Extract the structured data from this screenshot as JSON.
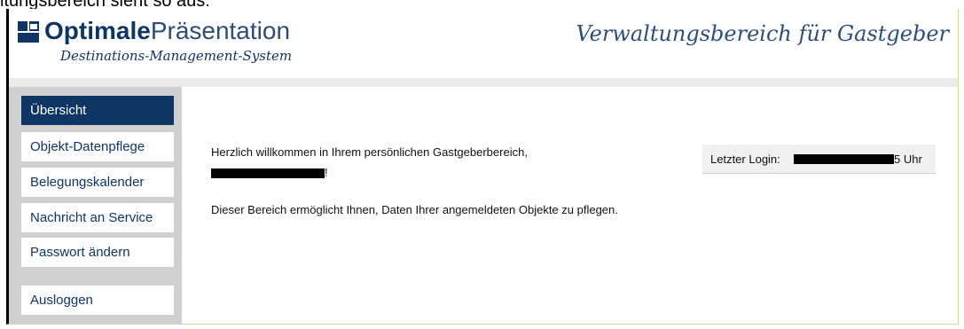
{
  "caption": "ltungsbereich sieht so aus:",
  "header": {
    "brand_bold": "Optimale",
    "brand_light": "Präsentation",
    "subtitle": "Destinations-Management-System",
    "right_title": "Verwaltungsbereich für Gastgeber"
  },
  "sidebar": {
    "items": [
      {
        "label": "Übersicht"
      },
      {
        "label": "Objekt-Datenpflege"
      },
      {
        "label": "Belegungskalender"
      },
      {
        "label": "Nachricht an Service"
      },
      {
        "label": "Passwort ändern"
      },
      {
        "label": "Ausloggen"
      }
    ]
  },
  "main": {
    "welcome": "Herzlich willkommen in Ihrem persönlichen Gastgeberbereich,",
    "name_suffix": "!",
    "info": "Dieser Bereich ermöglicht Ihnen, Daten Ihrer angemeldeten Objekte zu pflegen."
  },
  "login": {
    "label": "Letzter Login:",
    "suffix": "5 Uhr"
  },
  "colors": {
    "brand": "#0f3565",
    "sidebar_bg": "#d0d0d0",
    "active_bg": "#0f3565"
  }
}
